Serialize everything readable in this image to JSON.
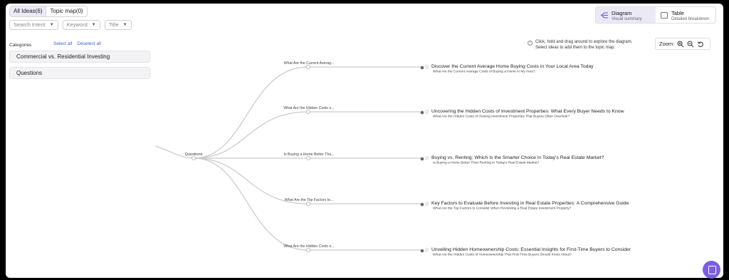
{
  "tabs": [
    {
      "label": "All Ideas(6)",
      "active": true
    },
    {
      "label": "Topic map(0)",
      "active": false
    }
  ],
  "filters": [
    "Search Intent",
    "Keyword",
    "Title"
  ],
  "categories": {
    "heading": "Categories",
    "select_all": "Select all",
    "deselect_all": "Deselect all",
    "items": [
      "Commercial vs. Residential Investing",
      "Questions"
    ]
  },
  "view_toggle": {
    "diagram": {
      "title": "Diagram",
      "subtitle": "Visual summary"
    },
    "table": {
      "title": "Table",
      "subtitle": "Detailed breakdown"
    }
  },
  "help": {
    "line1": "Click, hold and drag around to explore the diagram.",
    "line2": "Select ideas to add them to the topic map."
  },
  "zoom": {
    "label": "Zoom:"
  },
  "diagram": {
    "root": "Questions",
    "branches": [
      {
        "label": "What Are the Current Averag...",
        "title": "Discover the Current Average Home Buying Costs in Your Local Area Today",
        "question": "What Are the Current Average Costs of Buying a Home in My Area?"
      },
      {
        "label": "What Are the Hidden Costs o...",
        "title": "Uncovering the Hidden Costs of Investment Properties: What Every Buyer Needs to Know",
        "question": "What Are the Hidden Costs of Owning Investment Properties That Buyers Often Overlook?"
      },
      {
        "label": "Is Buying a Home Better Tha...",
        "title": "Buying vs. Renting: Which Is the Smarter Choice in Today’s Real Estate Market?",
        "question": "Is Buying a Home Better Than Renting in Today's Real Estate Market?"
      },
      {
        "label": "What Are the Top Factors to...",
        "title": "Key Factors to Evaluate Before Investing in Real Estate Properties: A Comprehensive Guide",
        "question": "What Are the Top Factors to Consider When Reviewing a Real Estate Investment Property?"
      },
      {
        "label": "What Are the Hidden Costs o...",
        "title": "Unveiling Hidden Homeownership Costs: Essential Insights for First-Time Buyers to Consider",
        "question": "What Are the Hidden Costs of Homeownership That First-Time Buyers Should Know About?"
      }
    ]
  }
}
